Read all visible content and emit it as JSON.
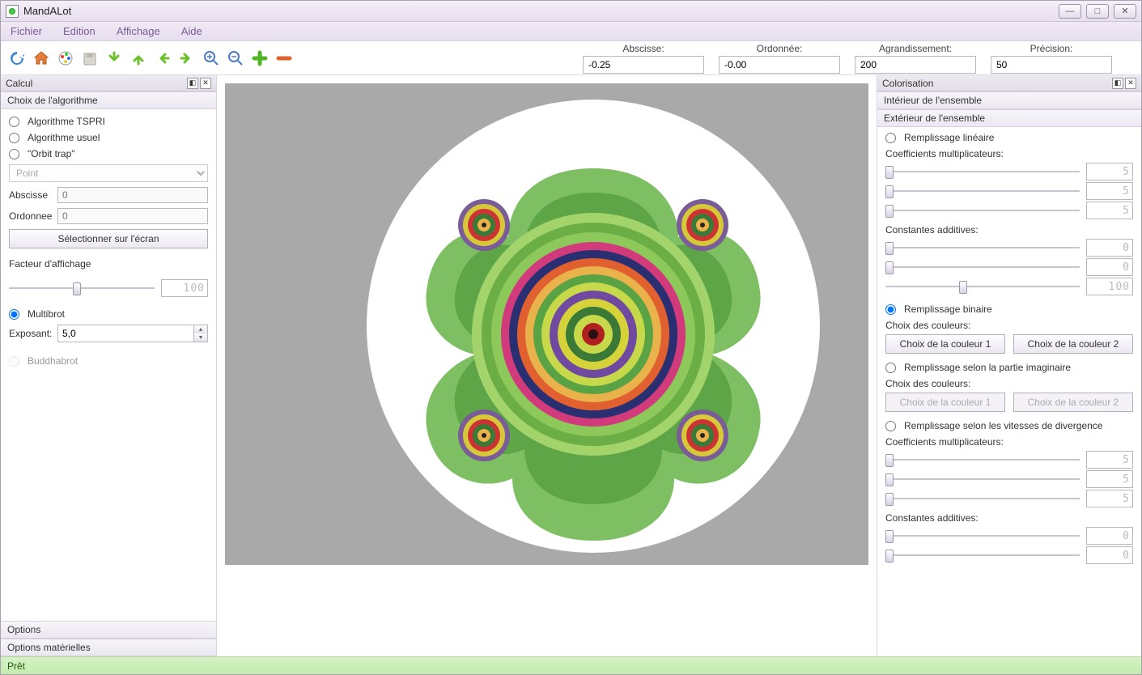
{
  "window": {
    "title": "MandALot"
  },
  "menu": {
    "file": "Fichier",
    "edit": "Edition",
    "view": "Affichage",
    "help": "Aide"
  },
  "fields": {
    "abscisse": {
      "label": "Abscisse:",
      "value": "-0.25"
    },
    "ordonnee": {
      "label": "Ordonnée:",
      "value": "-0.00"
    },
    "agrandissement": {
      "label": "Agrandissement:",
      "value": "200"
    },
    "precision": {
      "label": "Précision:",
      "value": "50"
    }
  },
  "left": {
    "calcul": "Calcul",
    "choix": "Choix de l'algorithme",
    "algo1": "Algorithme TSPRI",
    "algo2": "Algorithme usuel",
    "algo3": "\"Orbit trap\"",
    "point": "Point",
    "abscisse_lbl": "Abscisse",
    "abscisse_val": "0",
    "ordonnee_lbl": "Ordonnee",
    "ordonnee_val": "0",
    "select_btn": "Sélectionner sur l'écran",
    "facteur": "Facteur d'affichage",
    "facteur_disp": "100",
    "multibrot": "Multibrot",
    "exposant_lbl": "Exposant:",
    "exposant_val": "5,0",
    "buddhabrot": "Buddhabrot",
    "options": "Options",
    "options_mat": "Options matérielles"
  },
  "right": {
    "colorisation": "Colorisation",
    "interieur": "Intérieur de l'ensemble",
    "exterieur": "Extérieur de l'ensemble",
    "remp_lin": "Remplissage linéaire",
    "coef_mult": "Coefficients multiplicateurs:",
    "const_add": "Constantes additives:",
    "disp5": "5",
    "disp0": "0",
    "disp100": "100",
    "remp_bin": "Remplissage binaire",
    "choix_col": "Choix des couleurs:",
    "col1": "Choix de la couleur 1",
    "col2": "Choix de la couleur 2",
    "remp_imag": "Remplissage selon la partie imaginaire",
    "remp_div": "Remplissage selon les vitesses de divergence"
  },
  "status": "Prêt"
}
